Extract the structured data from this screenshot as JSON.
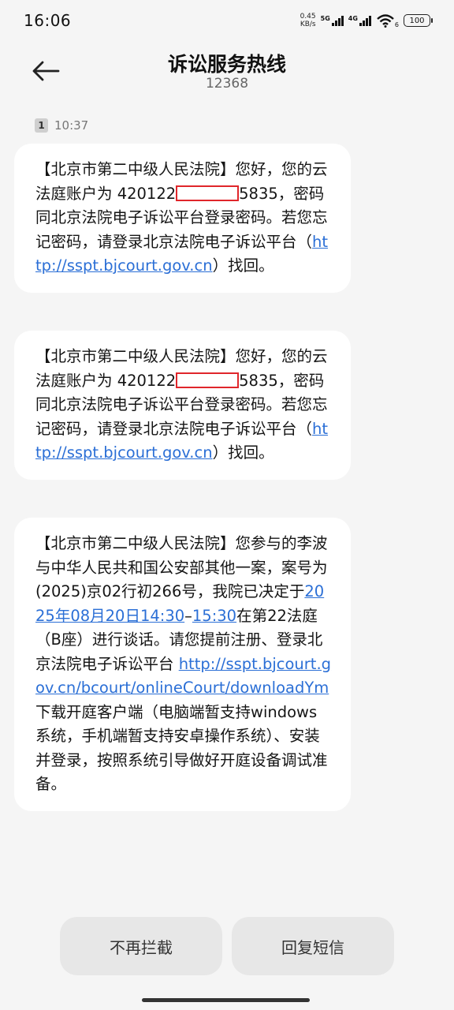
{
  "status": {
    "time": "16:06",
    "net_speed_value": "0.45",
    "net_speed_unit": "KB/s",
    "sig1_label": "5G",
    "sig2_label": "4G",
    "wifi_sub": "6",
    "battery": "100"
  },
  "header": {
    "title": "诉讼服务热线",
    "subtitle": "12368"
  },
  "meta": {
    "sim": "1",
    "time": "10:37"
  },
  "messages": [
    {
      "text_a": "【北京市第二中级人民法院】您好，您的云法庭账户为 420122",
      "text_b": "5835，密码同北京法院电子诉讼平台登录密码。若您忘记密码，请登录北京法院电子诉讼平台（",
      "link": "http://sspt.bjcourt.gov.cn",
      "text_c": "）找回。"
    },
    {
      "text_a": "【北京市第二中级人民法院】您好，您的云法庭账户为 420122",
      "text_b": "5835，密码同北京法院电子诉讼平台登录密码。若您忘记密码，请登录北京法院电子诉讼平台（",
      "link": "http://sspt.bjcourt.gov.cn",
      "text_c": "）找回。"
    },
    {
      "text_a": "【北京市第二中级人民法院】您参与的李波与中华人民共和国公安部其他一案，案号为(2025)京02行初266号，我院已决定于",
      "date_link": "2025年08月20日14:30",
      "dash": "–",
      "end_time_link": "15:30",
      "text_b": "在第22法庭（B座）进行谈话。请您提前注册、登录北京法院电子诉讼平台 ",
      "url_link": "http://sspt.bjcourt.gov.cn/bcourt/onlineCourt/downloadYm",
      "text_c": " 下载开庭客户端（电脑端暂支持windows系统，手机端暂支持安卓操作系统）、安装并登录，按照系统引导做好开庭设备调试准备。"
    }
  ],
  "actions": {
    "stop_block": "不再拦截",
    "reply": "回复短信"
  }
}
